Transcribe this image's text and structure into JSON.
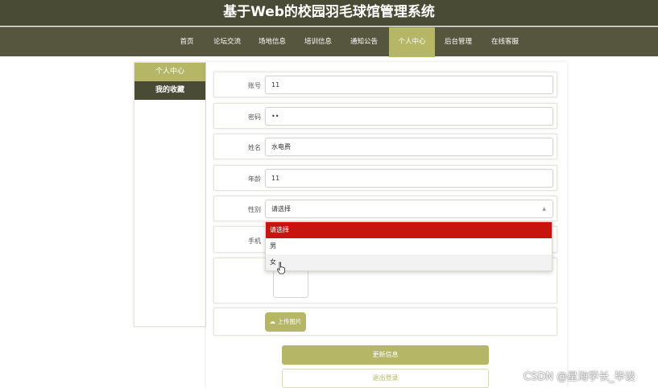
{
  "app": {
    "title": "基于Web的校园羽毛球馆管理系统"
  },
  "nav": {
    "items": [
      {
        "label": "首页"
      },
      {
        "label": "论坛交流"
      },
      {
        "label": "场地信息"
      },
      {
        "label": "培训信息"
      },
      {
        "label": "通知公告"
      },
      {
        "label": "个人中心"
      },
      {
        "label": "后台管理"
      },
      {
        "label": "在线客服"
      }
    ],
    "active": "个人中心"
  },
  "sidebar": {
    "items": [
      {
        "label": "个人中心"
      },
      {
        "label": "我的收藏"
      }
    ]
  },
  "form": {
    "account": {
      "label": "账号",
      "value": "11"
    },
    "password": {
      "label": "密码",
      "value": "••"
    },
    "name": {
      "label": "姓名",
      "value": "水电费"
    },
    "age": {
      "label": "年龄",
      "value": "11"
    },
    "gender": {
      "label": "性别",
      "value": "请选择"
    },
    "phone": {
      "label": "手机"
    },
    "upload_label": "上传图片"
  },
  "dropdown": {
    "options": [
      "请选择",
      "男",
      "女"
    ],
    "selected": "请选择",
    "hovered": "女"
  },
  "buttons": {
    "update": "更新信息",
    "logout": "退出登录"
  },
  "watermark": "CSDN @星海学长_毕设",
  "colors": {
    "header_bg": "#4a4b35",
    "accent": "#b5b766",
    "selected_option": "#c8140f"
  }
}
